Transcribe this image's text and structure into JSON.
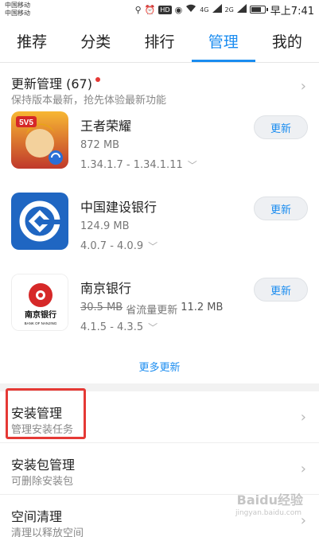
{
  "status_bar": {
    "carrier_1": "中国移动",
    "carrier_2": "中国移动",
    "hd": "HD",
    "sig1": "4G",
    "sig2": "2G",
    "time": "早上7:41",
    "battery_level": 0.8
  },
  "tabs": [
    {
      "label": "推荐",
      "active": false
    },
    {
      "label": "分类",
      "active": false
    },
    {
      "label": "排行",
      "active": false
    },
    {
      "label": "管理",
      "active": true
    },
    {
      "label": "我的",
      "active": false
    }
  ],
  "update_manager": {
    "title": "更新管理 (67)",
    "subtitle": "保持版本最新，抢先体验最新功能"
  },
  "apps": [
    {
      "name": "王者荣耀",
      "size": "872 MB",
      "size_old": "",
      "save_label": "",
      "save_size": "",
      "version": "1.34.1.7 - 1.34.1.11",
      "button": "更新"
    },
    {
      "name": "中国建设银行",
      "size": "124.9 MB",
      "size_old": "",
      "save_label": "",
      "save_size": "",
      "version": "4.0.7 - 4.0.9",
      "button": "更新"
    },
    {
      "name": "南京银行",
      "size": "",
      "size_old": "30.5 MB",
      "save_label": "省流量更新",
      "save_size": "11.2 MB",
      "version": "4.1.5 - 4.3.5",
      "button": "更新"
    }
  ],
  "more_updates": "更多更新",
  "menu": [
    {
      "title": "安装管理",
      "subtitle": "管理安装任务"
    },
    {
      "title": "安装包管理",
      "subtitle": "可删除安装包"
    },
    {
      "title": "空间清理",
      "subtitle": "清理以释放空间"
    }
  ],
  "icon_labels": {
    "wzry_badge": "5V5",
    "njb_text": "南京银行",
    "njb_en": "BANK OF NANJING"
  },
  "watermark": {
    "text": "Baidu经验",
    "sub": "jingyan.baidu.com"
  }
}
